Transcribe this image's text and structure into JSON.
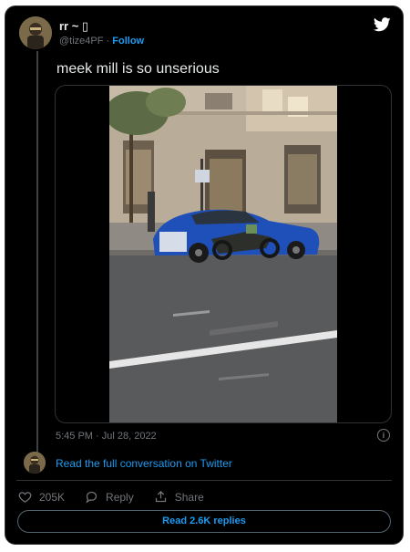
{
  "author": {
    "name": "rr ~ ▯",
    "handle": "@tize4PF",
    "separator": "·",
    "follow_label": "Follow"
  },
  "tweet": {
    "text": "meek mill is so unserious",
    "timestamp": "5:45 PM · Jul 28, 2022"
  },
  "icons": {
    "brand": "twitter-bird-icon",
    "info": "info-icon",
    "like": "heart-icon",
    "reply": "reply-bubble-icon",
    "share": "share-icon"
  },
  "conversation": {
    "label": "Read the full conversation on Twitter"
  },
  "actions": {
    "like_count": "205K",
    "reply_label": "Reply",
    "share_label": "Share"
  },
  "footer": {
    "replies_label": "Read 2.6K replies"
  },
  "colors": {
    "background": "#000000",
    "accent": "#1d9bf0",
    "muted": "#71767b",
    "border": "#2f3336"
  }
}
